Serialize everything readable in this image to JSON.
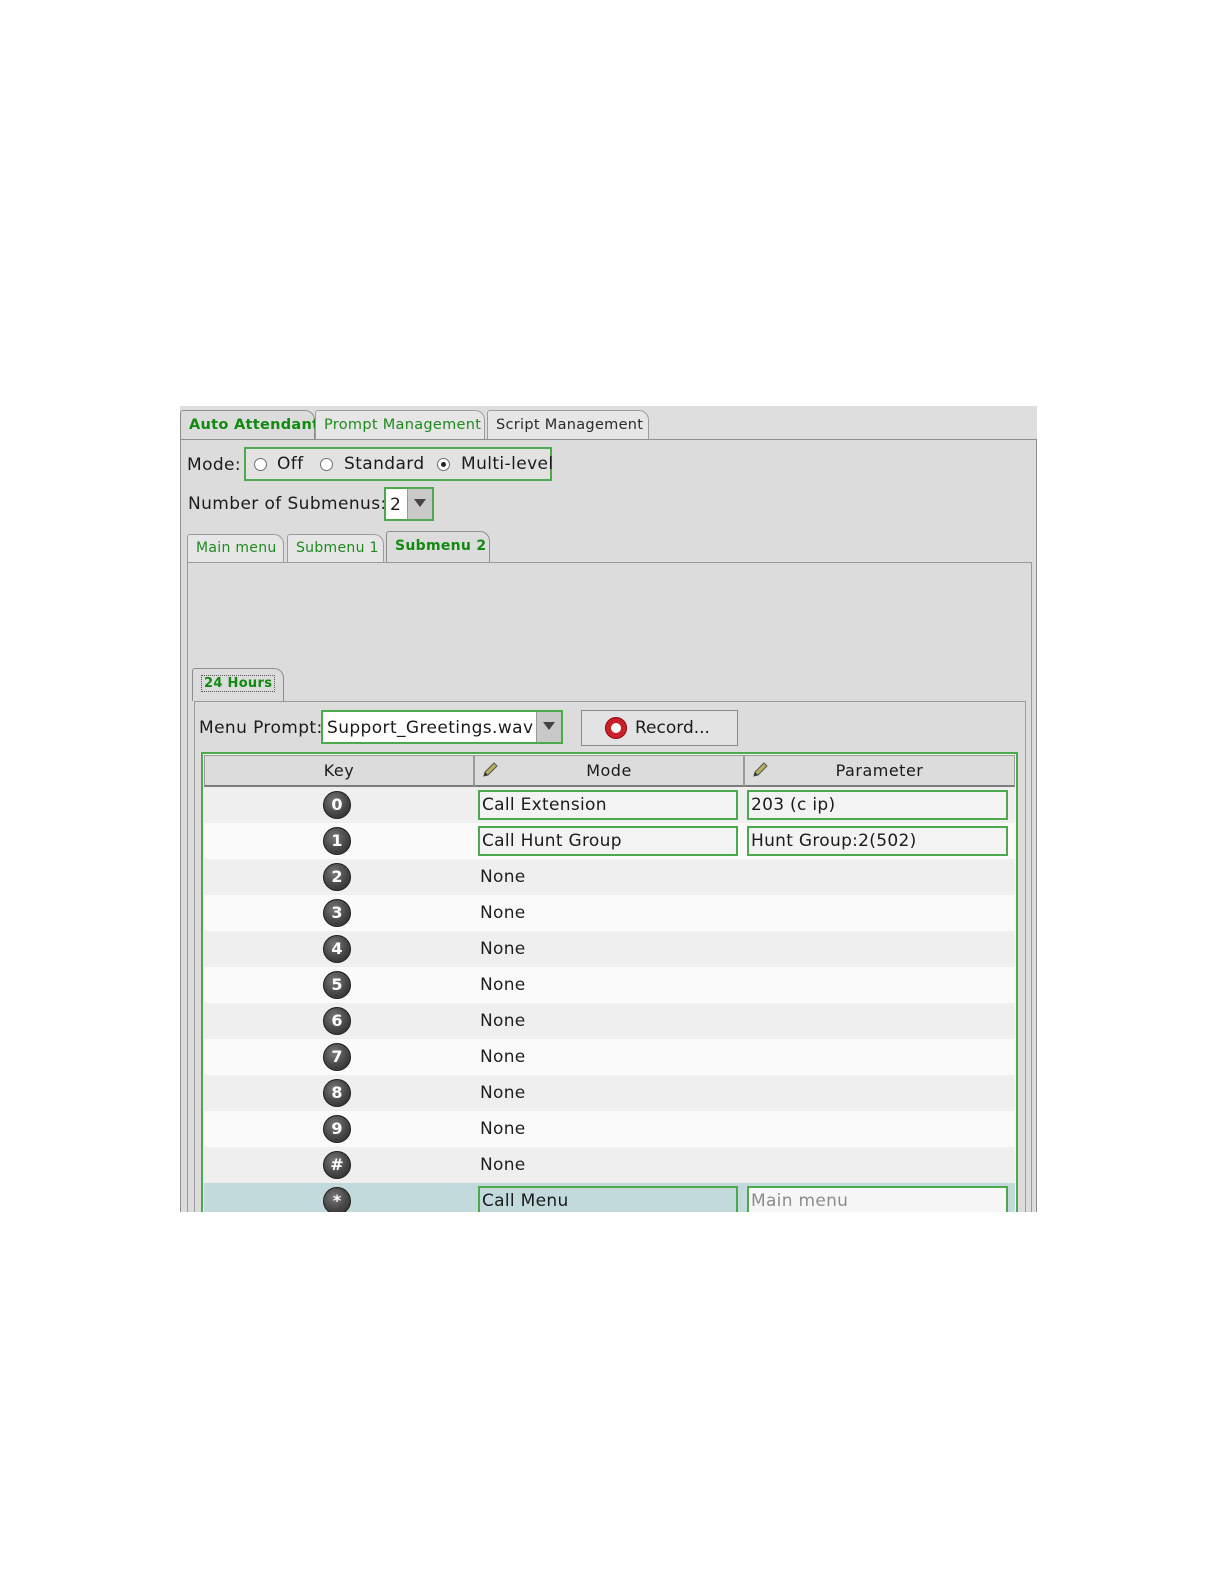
{
  "top_tabs": [
    {
      "label": "Auto Attendant"
    },
    {
      "label": "Prompt Management"
    },
    {
      "label": "Script Management"
    }
  ],
  "mode": {
    "label": "Mode:",
    "options": [
      {
        "label": "Off",
        "checked": false
      },
      {
        "label": "Standard",
        "checked": false
      },
      {
        "label": "Multi-level",
        "checked": true
      }
    ]
  },
  "submenus": {
    "label": "Number of Submenus:",
    "value": "2"
  },
  "menu_tabs": [
    {
      "label": "Main menu"
    },
    {
      "label": "Submenu 1"
    },
    {
      "label": "Submenu 2"
    }
  ],
  "schedule_tab": {
    "label": "24 Hours"
  },
  "menu_prompt": {
    "label": "Menu Prompt:",
    "value": "Support_Greetings.wav"
  },
  "record_button": {
    "label": "Record..."
  },
  "table": {
    "headers": {
      "key": "Key",
      "mode": "Mode",
      "parameter": "Parameter"
    },
    "rows": [
      {
        "key": "0",
        "mode": "Call Extension",
        "parameter": "203 (c ip)"
      },
      {
        "key": "1",
        "mode": "Call Hunt Group",
        "parameter": "Hunt Group:2(502)"
      },
      {
        "key": "2",
        "mode": "None",
        "parameter": ""
      },
      {
        "key": "3",
        "mode": "None",
        "parameter": ""
      },
      {
        "key": "4",
        "mode": "None",
        "parameter": ""
      },
      {
        "key": "5",
        "mode": "None",
        "parameter": ""
      },
      {
        "key": "6",
        "mode": "None",
        "parameter": ""
      },
      {
        "key": "7",
        "mode": "None",
        "parameter": ""
      },
      {
        "key": "8",
        "mode": "None",
        "parameter": ""
      },
      {
        "key": "9",
        "mode": "None",
        "parameter": ""
      },
      {
        "key": "#",
        "mode": "None",
        "parameter": ""
      },
      {
        "key": "*",
        "mode": "Call Menu",
        "parameter_placeholder": "Main menu"
      }
    ]
  },
  "colors": {
    "accent_green": "#4caa4c",
    "tab_text_green": "#118a11",
    "selected_row": "#c2dadb",
    "record_red": "#cc1f2c"
  },
  "icons": {
    "header_edit": "pencil-icon",
    "record": "record-icon",
    "dropdown": "chevron-down-icon"
  }
}
